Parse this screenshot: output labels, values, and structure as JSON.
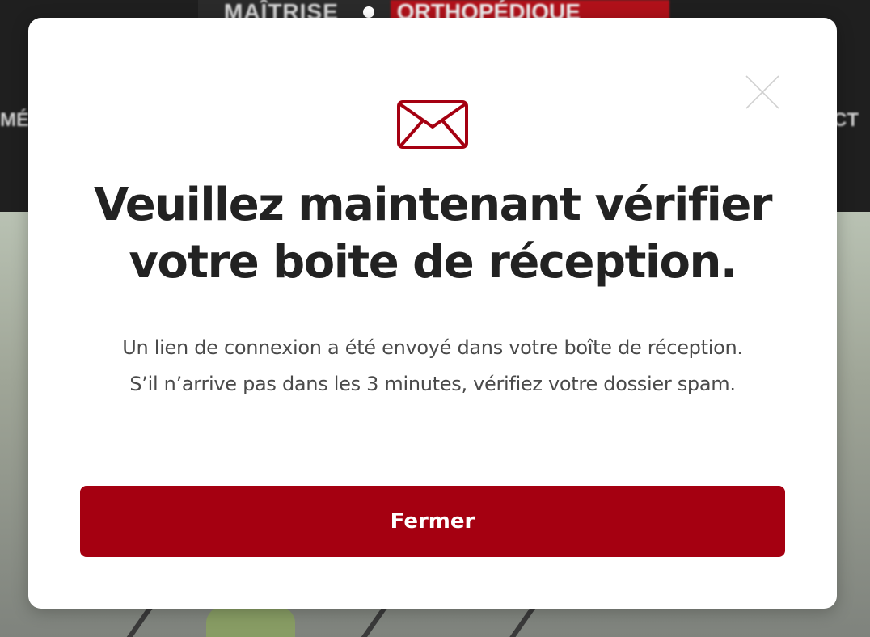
{
  "background": {
    "logo_left": "MAÎTRISE",
    "logo_right": "ORTHOPÉDIQUE",
    "nav_left_fragment": "MÉ",
    "nav_right_fragment": "CT"
  },
  "modal": {
    "title_line1": "Veuillez maintenant vérifier",
    "title_line2": "votre boite de réception.",
    "message": "Un lien de connexion a été envoyé dans votre boîte de réception. S’il n’arrive pas dans les 3 minutes, vérifiez votre dossier spam.",
    "close_button_label": "Fermer",
    "icon": "envelope-icon",
    "close_icon": "close-icon"
  },
  "colors": {
    "accent": "#a50011",
    "title_text": "#222222",
    "body_text": "#4a4a4a",
    "close_icon": "#d0d0d0"
  }
}
